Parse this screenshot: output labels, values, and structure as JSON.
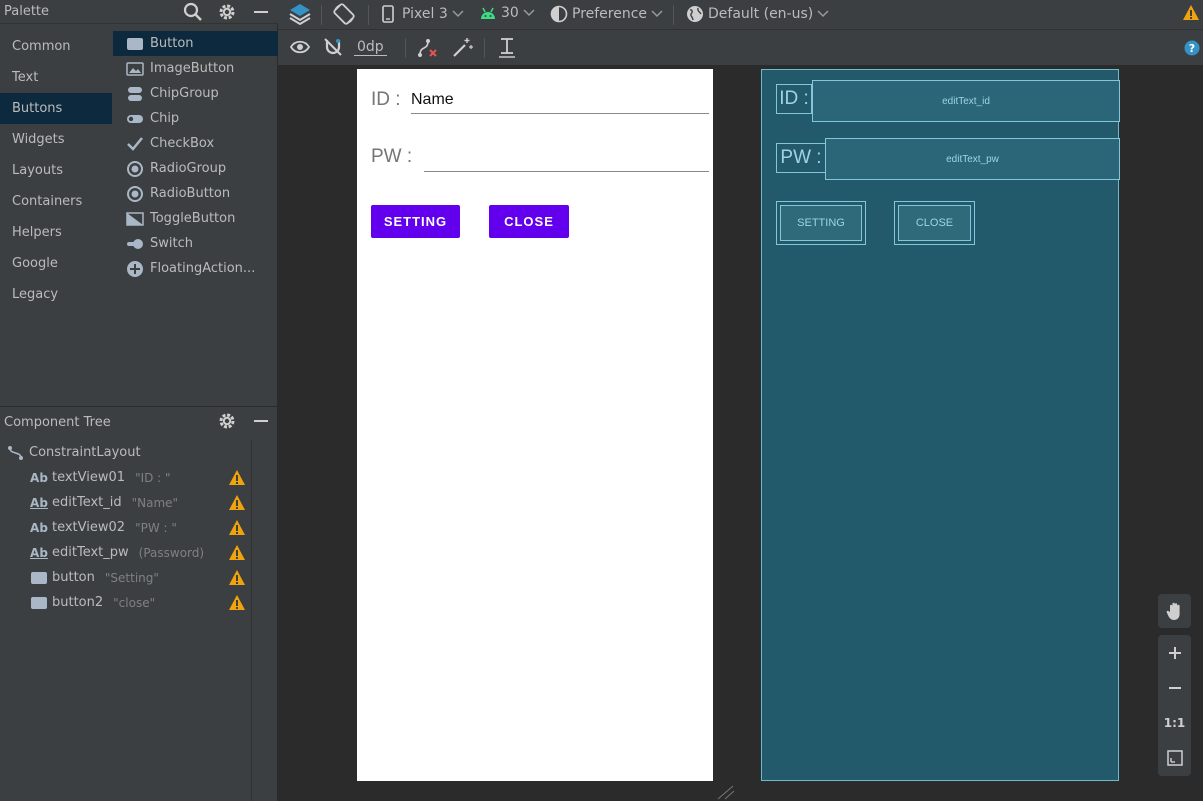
{
  "palette": {
    "title": "Palette",
    "categories": [
      "Common",
      "Text",
      "Buttons",
      "Widgets",
      "Layouts",
      "Containers",
      "Helpers",
      "Google",
      "Legacy"
    ],
    "selected_category": "Buttons",
    "items": [
      "Button",
      "ImageButton",
      "ChipGroup",
      "Chip",
      "CheckBox",
      "RadioGroup",
      "RadioButton",
      "ToggleButton",
      "Switch",
      "FloatingAction..."
    ],
    "selected_item": "Button"
  },
  "component_tree": {
    "title": "Component Tree",
    "root": "ConstraintLayout",
    "nodes": [
      {
        "icon": "Ab",
        "name": "textView01",
        "value": "\"ID : \""
      },
      {
        "icon": "Ab",
        "name": "editText_id",
        "value": "\"Name\""
      },
      {
        "icon": "Ab",
        "name": "textView02",
        "value": "\"PW : \""
      },
      {
        "icon": "Ab",
        "name": "editText_pw",
        "value": "(Password)"
      },
      {
        "icon": "btn",
        "name": "button",
        "value": "\"Setting\""
      },
      {
        "icon": "btn",
        "name": "button2",
        "value": "\"close\""
      }
    ]
  },
  "toolbar": {
    "device": "Pixel 3",
    "api": "30",
    "theme": "Preference",
    "locale": "Default (en-us)",
    "margin": "0dp"
  },
  "design": {
    "id_label": "ID :",
    "name_value": "Name",
    "pw_label": "PW :",
    "setting_button": "SETTING",
    "close_button": "CLOSE"
  },
  "blueprint": {
    "id_label": "ID :",
    "edit_id": "editText_id",
    "pw_label": "PW :",
    "edit_pw": "editText_pw",
    "setting": "SETTING",
    "close": "CLOSE"
  },
  "zoom": {
    "one_to_one": "1:1"
  },
  "colors": {
    "accent": "#6200ee",
    "blueprint": "#235a6b",
    "warning": "#f0a30a"
  }
}
